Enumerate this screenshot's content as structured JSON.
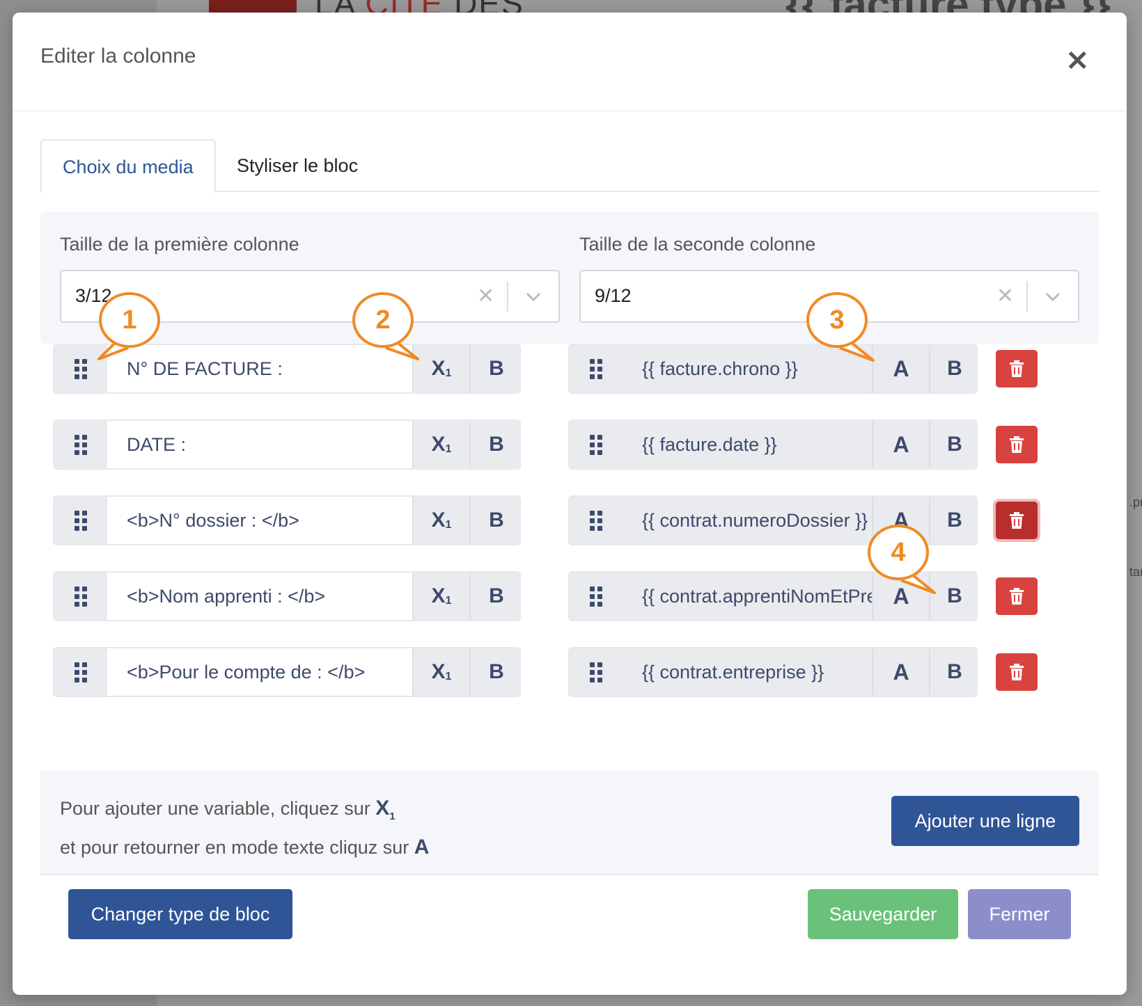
{
  "background": {
    "title_a": "LA ",
    "title_b": "CITE",
    "title_c": " DES",
    "template_tag": "{{ facture.type }}",
    "side_text_1": ".pr",
    "side_text_2": "tar"
  },
  "modal": {
    "title": "Editer la colonne",
    "close_symbol": "✕"
  },
  "tabs": [
    {
      "label": "Choix du media",
      "active": true
    },
    {
      "label": "Styliser le bloc",
      "active": false
    }
  ],
  "sizes": {
    "first_label": "Taille de la première colonne",
    "first_value": "3/12",
    "second_label": "Taille de la seconde colonne",
    "second_value": "9/12",
    "clear_symbol": "✕"
  },
  "rows": [
    {
      "left": "N° DE FACTURE :",
      "right": "{{ facture.chrono }}"
    },
    {
      "left": "DATE :",
      "right": "{{ facture.date }}"
    },
    {
      "left": "<b>N° dossier : </b>",
      "right": "{{ contrat.numeroDossier }}"
    },
    {
      "left": "<b>Nom apprenti : </b>",
      "right": "{{ contrat.apprentiNomEtPrenom }}"
    },
    {
      "left": "<b>Pour le compte de : </b>",
      "right": "{{ contrat.entreprise }}"
    }
  ],
  "buttons": {
    "variable_main": "X",
    "variable_sub": "1",
    "text_mode": "A",
    "bold": "B"
  },
  "callouts": [
    "1",
    "2",
    "3",
    "4"
  ],
  "help": {
    "line1": "Pour ajouter une variable, cliquez sur ",
    "line2": "et pour retourner en mode texte cliquz sur ",
    "icon_x": "X",
    "icon_x_sub": "1",
    "icon_a": "A"
  },
  "actions": {
    "add_line": "Ajouter une ligne",
    "change_type": "Changer type de bloc",
    "save": "Sauvegarder",
    "close": "Fermer"
  },
  "colors": {
    "primary": "#2f5597",
    "success": "#6ac17a",
    "secondary": "#8c8dcb",
    "danger": "#d9433f",
    "callout": "#f08a24"
  }
}
